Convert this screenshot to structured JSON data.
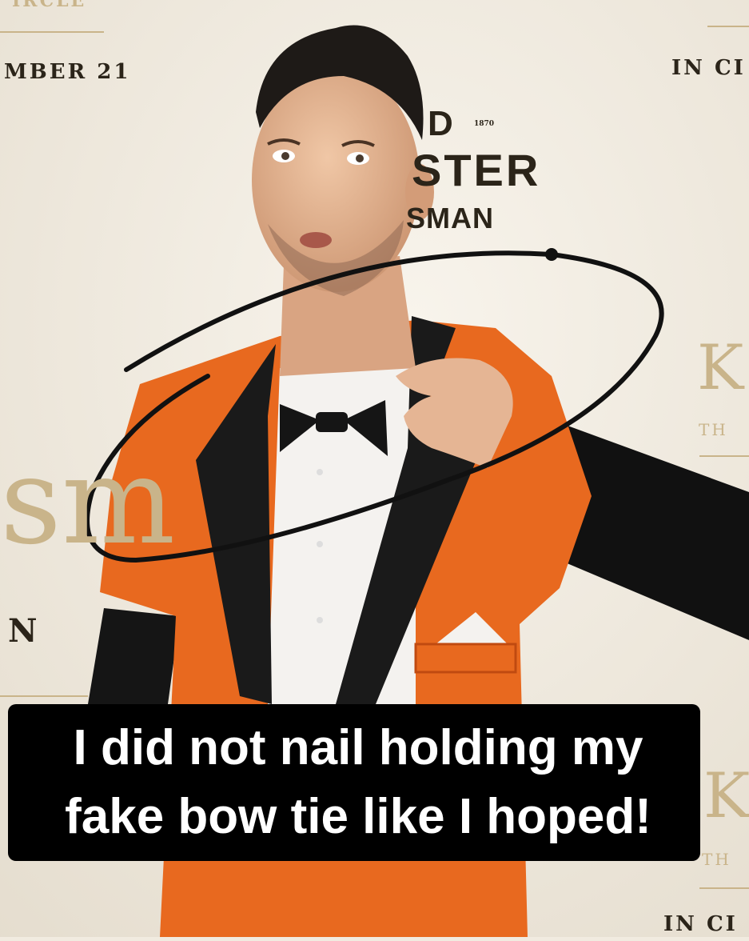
{
  "photo": {
    "subject": "man in orange tuxedo print t-shirt holding printed bow tie",
    "backdrop_text": {
      "top_left": "IRCLE",
      "date": "MBER 21",
      "top_right": "IN CI",
      "logo_top": "D",
      "logo_year": "1870",
      "logo_mid": "STER",
      "logo_bottom": "SMAN",
      "right_big": "K",
      "right_small": "TH",
      "left_big": "sm",
      "left_small": "N",
      "right_big_2": "K",
      "right_small_2": "TH",
      "bottom_right": "IN CI"
    }
  },
  "caption": {
    "line1": "I did not nail holding my",
    "line2": "fake bow tie like I hoped!"
  },
  "colors": {
    "orange": "#e8691f",
    "caption_bg": "#000000",
    "caption_text": "#ffffff"
  }
}
